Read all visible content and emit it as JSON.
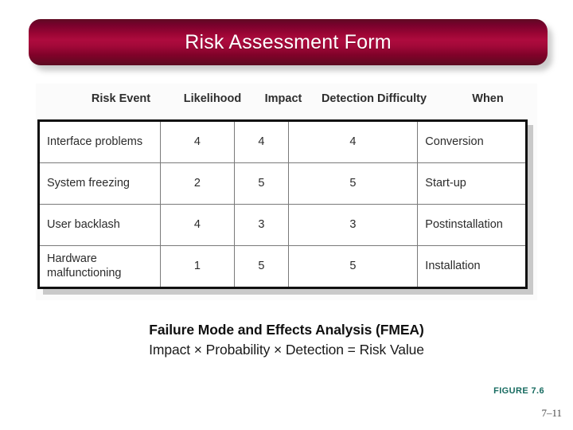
{
  "banner": {
    "title": "Risk Assessment Form",
    "gradient_top": "#5e0b22",
    "gradient_mid": "#ae0b3e",
    "gradient_bottom": "#5c0b21"
  },
  "table": {
    "columns": [
      "Risk Event",
      "Likelihood",
      "Impact",
      "Detection Difficulty",
      "When"
    ],
    "rows": [
      {
        "risk_event": "Interface problems",
        "likelihood": "4",
        "impact": "4",
        "detection_difficulty": "4",
        "when": "Conversion"
      },
      {
        "risk_event": "System freezing",
        "likelihood": "2",
        "impact": "5",
        "detection_difficulty": "5",
        "when": "Start-up"
      },
      {
        "risk_event": "User backlash",
        "likelihood": "4",
        "impact": "3",
        "detection_difficulty": "3",
        "when": "Postinstallation"
      },
      {
        "risk_event": "Hardware malfunctioning",
        "likelihood": "1",
        "impact": "5",
        "detection_difficulty": "5",
        "when": "Installation"
      }
    ]
  },
  "caption": {
    "line1": "Failure Mode and Effects Analysis (FMEA)",
    "line2": "Impact × Probability × Detection = Risk Value"
  },
  "figure": {
    "label": "FIGURE 7.6",
    "label_color": "#176b60",
    "page_number": "7–11"
  }
}
